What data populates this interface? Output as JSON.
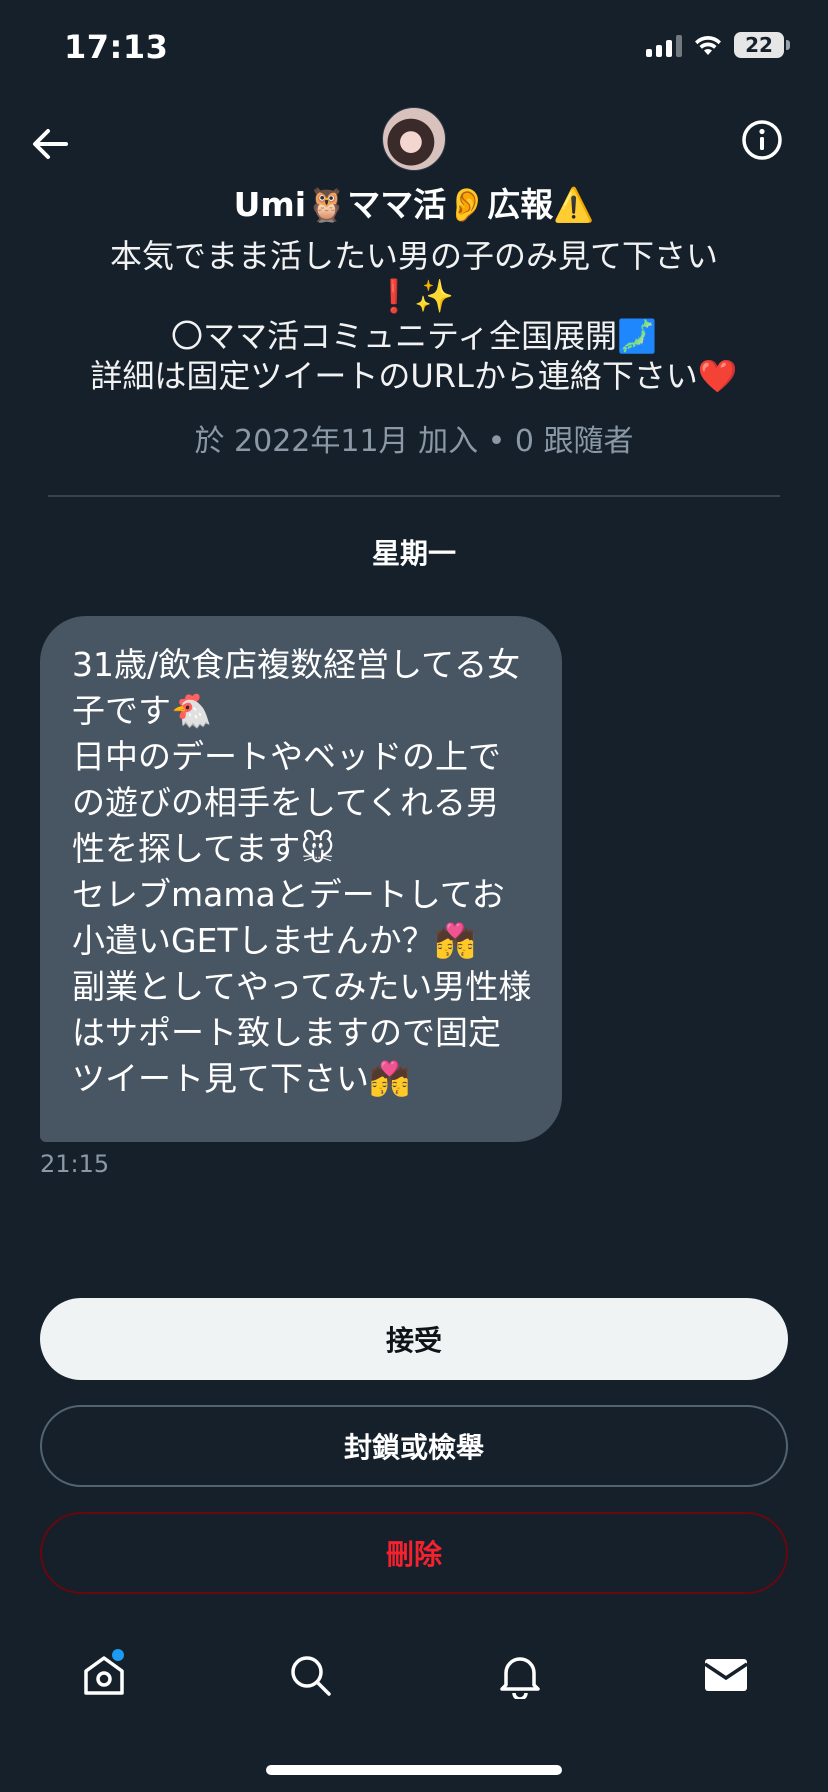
{
  "status_bar": {
    "time": "17:13",
    "battery": "22"
  },
  "header": {
    "back_icon": "arrow-left-icon",
    "info_icon": "info-circle-icon"
  },
  "profile": {
    "name": "Umi🦉ママ活👂広報⚠️",
    "bio": "本気でまま活したい男の子のみ見て下さい\n❗✨\n〇ママ活コミュニティ全国展開🗾\n詳細は固定ツイートのURLから連絡下さい❤️",
    "meta": "於 2022年11月 加入 • 0 跟隨者"
  },
  "conversation": {
    "day_label": "星期一",
    "message": {
      "text": "31歳/飲食店複数経営してる女子です🐔\n日中のデートやベッドの上での遊びの相手をしてくれる男性を探してます🐭\nセレブmamaとデートしてお小遣いGETしませんか？💏\n副業としてやってみたい男性様はサポート致しますので固定ツイート見て下さい💏",
      "time": "21:15"
    }
  },
  "actions": {
    "accept": "接受",
    "block_report": "封鎖或檢舉",
    "delete": "刪除"
  },
  "tab_bar": {
    "items": [
      "home-icon",
      "search-icon",
      "bell-icon",
      "mail-icon"
    ]
  },
  "colors": {
    "background": "#15202b",
    "bubble": "#485563",
    "accent": "#1d9bf0",
    "danger": "#f4212e"
  }
}
